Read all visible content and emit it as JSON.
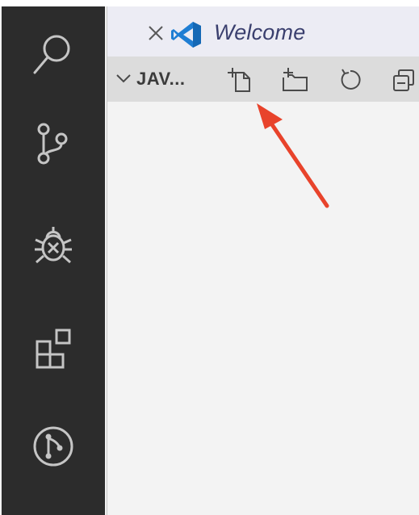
{
  "activity_bar": {
    "background": "#2c2c2c",
    "icon_color": "#c5c5c5",
    "items": [
      {
        "name": "search",
        "icon": "search-icon"
      },
      {
        "name": "source-control",
        "icon": "source-control-icon"
      },
      {
        "name": "debug",
        "icon": "debug-bug-icon"
      },
      {
        "name": "extensions",
        "icon": "extensions-icon"
      },
      {
        "name": "git-graph",
        "icon": "git-graph-icon"
      }
    ]
  },
  "editor": {
    "tab": {
      "label": "Welcome",
      "close_icon": "close-icon",
      "logo_icon": "vscode-logo-icon",
      "logo_color": "#1f7ed3"
    }
  },
  "explorer": {
    "section_title": "JAV...",
    "chevron_icon": "chevron-down-icon",
    "toolbar": [
      {
        "name": "new-file",
        "icon": "new-file-icon"
      },
      {
        "name": "new-folder",
        "icon": "new-folder-icon"
      },
      {
        "name": "refresh",
        "icon": "refresh-icon"
      },
      {
        "name": "collapse-all",
        "icon": "collapse-all-icon"
      }
    ]
  },
  "annotation": {
    "arrow_color": "#e8432b",
    "points_to": "new-file-button"
  }
}
